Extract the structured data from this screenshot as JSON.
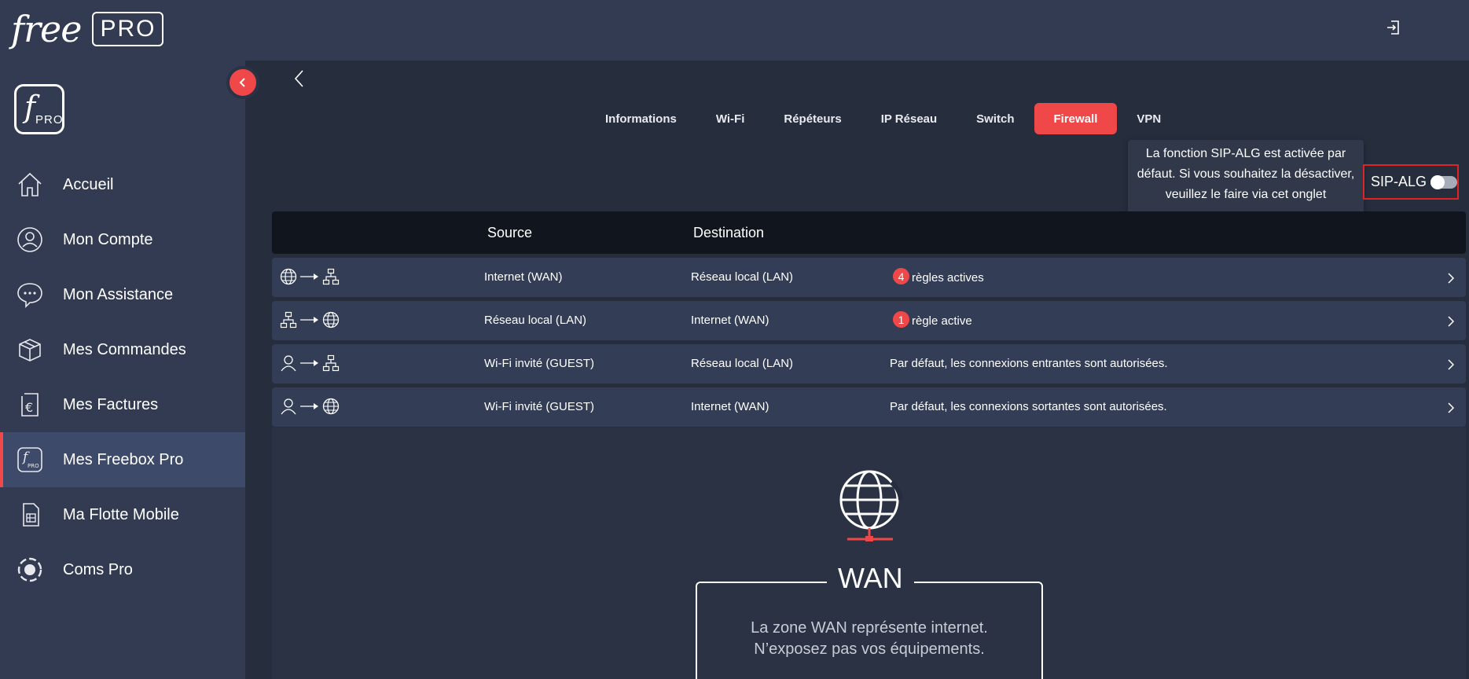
{
  "header": {
    "logo_text": "free",
    "logo_badge": "PRO",
    "logout_icon": "logout-icon"
  },
  "sidebar": {
    "brand_tile": {
      "letter": "f",
      "badge": "PRO"
    },
    "items": [
      {
        "label": "Accueil",
        "icon": "home-icon",
        "active": false
      },
      {
        "label": "Mon Compte",
        "icon": "user-icon",
        "active": false
      },
      {
        "label": "Mon Assistance",
        "icon": "chat-icon",
        "active": false
      },
      {
        "label": "Mes Commandes",
        "icon": "box-icon",
        "active": false
      },
      {
        "label": "Mes Factures",
        "icon": "invoice-icon",
        "active": false
      },
      {
        "label": "Mes Freebox Pro",
        "icon": "freebox-pro-icon",
        "active": true
      },
      {
        "label": "Ma Flotte Mobile",
        "icon": "sim-card-icon",
        "active": false
      },
      {
        "label": "Coms Pro",
        "icon": "coms-icon",
        "active": false
      }
    ]
  },
  "tabs": [
    {
      "label": "Informations",
      "active": false
    },
    {
      "label": "Wi-Fi",
      "active": false
    },
    {
      "label": "Répéteurs",
      "active": false
    },
    {
      "label": "IP Réseau",
      "active": false
    },
    {
      "label": "Switch",
      "active": false
    },
    {
      "label": "Firewall",
      "active": true
    },
    {
      "label": "VPN",
      "active": false
    }
  ],
  "sip_alg": {
    "label": "SIP-ALG",
    "enabled": false,
    "tooltip": "La fonction SIP-ALG est activée par défaut. Si vous souhaitez la désactiver, veuillez le faire via cet onglet"
  },
  "table": {
    "headers": {
      "source": "Source",
      "destination": "Destination"
    },
    "rows": [
      {
        "from_icon": "globe-icon",
        "to_icon": "network-icon",
        "source": "Internet (WAN)",
        "destination": "Réseau local (LAN)",
        "badge": "4",
        "status": "règles actives"
      },
      {
        "from_icon": "network-icon",
        "to_icon": "globe-icon",
        "source": "Réseau local (LAN)",
        "destination": "Internet (WAN)",
        "badge": "1",
        "status": "règle active"
      },
      {
        "from_icon": "guest-icon",
        "to_icon": "network-icon",
        "source": "Wi-Fi invité (GUEST)",
        "destination": "Réseau local (LAN)",
        "badge": "",
        "status": "Par défaut, les connexions entrantes sont autorisées."
      },
      {
        "from_icon": "guest-icon",
        "to_icon": "globe-icon",
        "source": "Wi-Fi invité (GUEST)",
        "destination": "Internet (WAN)",
        "badge": "",
        "status": "Par défaut, les connexions sortantes sont autorisées."
      }
    ]
  },
  "wan": {
    "title": "WAN",
    "line1": "La zone WAN représente internet.",
    "line2": "N’exposez pas vos équipements."
  },
  "colors": {
    "accent": "#f04848",
    "sidebar_bg": "#323b51",
    "main_bg": "#262e3e",
    "row_bg": "#333e56",
    "header_row_bg": "#11151d"
  }
}
